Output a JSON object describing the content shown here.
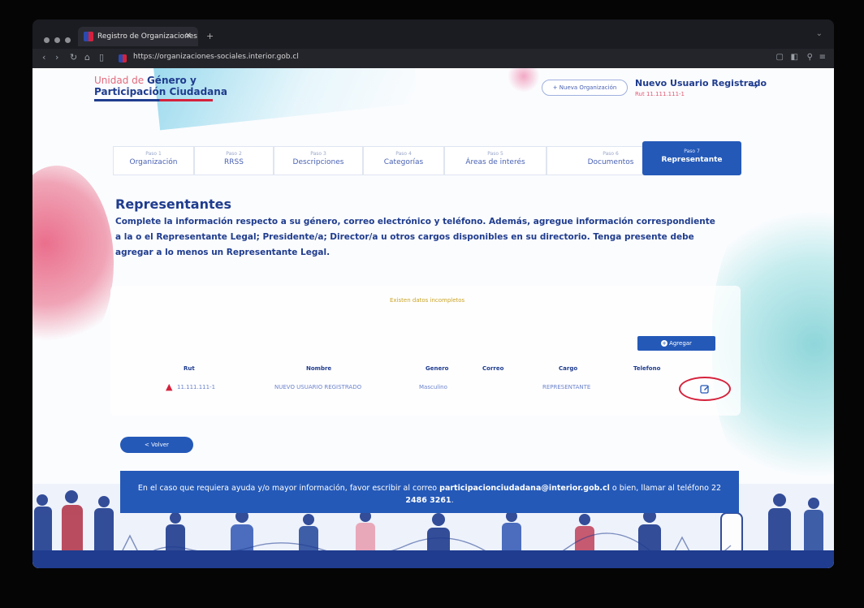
{
  "browser": {
    "tab_title": "Registro de Organizaciones",
    "tab_close": "✕",
    "new_tab": "+",
    "url": "https://organizaciones-sociales.interior.gob.cl"
  },
  "header": {
    "logo_line1_prefix": "Unidad de ",
    "logo_line1_bold": "Género y",
    "logo_line2": "Participación Ciudadana",
    "new_org_button": "+ Nueva Organización",
    "user_name": "Nuevo Usuario Registrado",
    "user_rut": "Rut 11.111.111-1"
  },
  "steps": [
    {
      "num": "Paso 1",
      "label": "Organización"
    },
    {
      "num": "Paso 2",
      "label": "RRSS"
    },
    {
      "num": "Paso 3",
      "label": "Descripciones"
    },
    {
      "num": "Paso 4",
      "label": "Categorías"
    },
    {
      "num": "Paso 5",
      "label": "Áreas de interés"
    },
    {
      "num": "Paso 6",
      "label": "Documentos"
    },
    {
      "num": "Paso 7",
      "label": "Representante"
    }
  ],
  "main": {
    "title": "Representantes",
    "description": "Complete la información respecto a su género, correo electrónico y teléfono. Además, agregue información correspondiente a la o el Representante Legal; Presidente/a; Director/a u otros cargos disponibles en su directorio. Tenga presente debe agregar a lo menos un Representante Legal.",
    "warning": "Existen datos incompletos",
    "add_button": "Agregar"
  },
  "table": {
    "headers": [
      "Rut",
      "Nombre",
      "Genero",
      "Correo",
      "Cargo",
      "Telefono"
    ],
    "row": {
      "rut": "11.111.111-1",
      "nombre": "NUEVO USUARIO REGISTRADO",
      "genero": "Masculino",
      "correo": "",
      "cargo": "REPRESENTANTE",
      "telefono": ""
    }
  },
  "back_button": "< Volver",
  "help": {
    "text_before": "En el caso que requiera ayuda y/o mayor información, favor escribir al correo ",
    "email": "participacionciudadana@interior.gob.cl",
    "text_middle": " o bien, llamar al teléfono 22 ",
    "phone": "2486 3261",
    "text_after": "."
  },
  "colors": {
    "primary": "#2459b8",
    "navy": "#1f3c8e",
    "accent_red": "#d5223c",
    "warning": "#c9a425"
  }
}
